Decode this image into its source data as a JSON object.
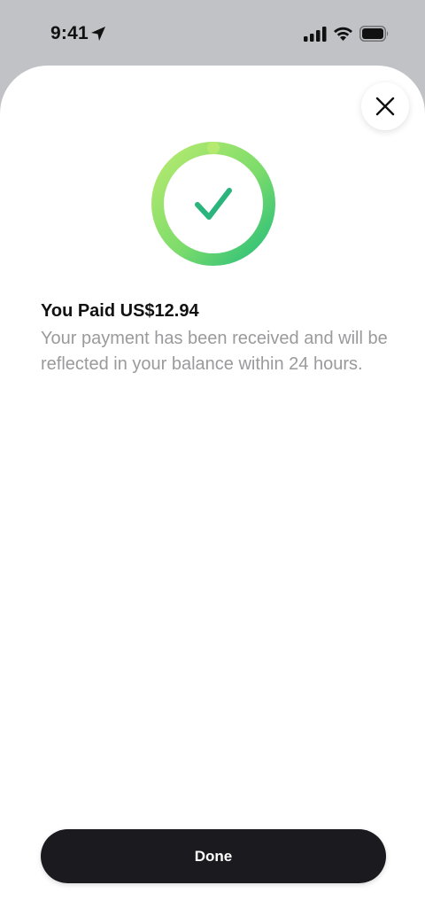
{
  "status_bar": {
    "time": "9:41",
    "icons": [
      "location-arrow-icon",
      "cellular-signal-icon",
      "wifi-icon",
      "battery-icon"
    ]
  },
  "header": {
    "close_icon": "close-icon"
  },
  "success": {
    "icon": "checkmark-icon",
    "ring_colors": {
      "start": "#b7ea6f",
      "mid": "#7ddc6b",
      "end": "#27be7b",
      "check": "#2bb57c"
    }
  },
  "content": {
    "title": "You Paid US$12.94",
    "message": "Your payment has been received and will be reflected in your balance within 24 hours."
  },
  "actions": {
    "done_label": "Done"
  },
  "colors": {
    "status_bar_bg": "#c1c2c6",
    "sheet_bg": "#ffffff",
    "button_bg": "#1b1a1e",
    "secondary_text": "#9a9a9c"
  }
}
